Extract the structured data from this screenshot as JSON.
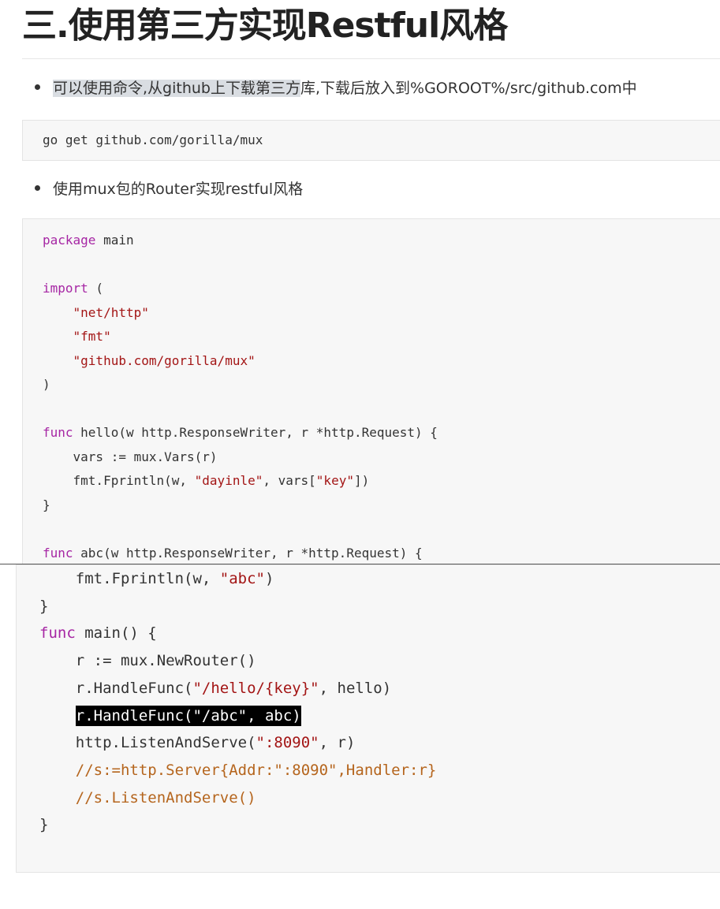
{
  "heading": "三.使用第三方实现Restful风格",
  "bullets": [
    {
      "highlighted": "可以使用命令,从github上下载第三方",
      "rest": "库,下载后放入到%GOROOT%/src/github.com中"
    },
    {
      "text": "使用mux包的Router实现restful风格"
    }
  ],
  "command": "go get github.com/gorilla/mux",
  "code_top": [
    [
      {
        "t": "package",
        "c": "kw"
      },
      {
        "t": " main"
      }
    ],
    [],
    [
      {
        "t": "import",
        "c": "kw"
      },
      {
        "t": " ("
      }
    ],
    [
      {
        "t": "    "
      },
      {
        "t": "\"net/http\"",
        "c": "str"
      }
    ],
    [
      {
        "t": "    "
      },
      {
        "t": "\"fmt\"",
        "c": "str"
      }
    ],
    [
      {
        "t": "    "
      },
      {
        "t": "\"github.com/gorilla/mux\"",
        "c": "str"
      }
    ],
    [
      {
        "t": ")"
      }
    ],
    [],
    [
      {
        "t": "func",
        "c": "kw"
      },
      {
        "t": " hello(w http.ResponseWriter, r *http.Request) {"
      }
    ],
    [
      {
        "t": "    vars := mux.Vars(r)"
      }
    ],
    [
      {
        "t": "    fmt.Fprintln(w, "
      },
      {
        "t": "\"dayinle\"",
        "c": "str"
      },
      {
        "t": ", vars["
      },
      {
        "t": "\"key\"",
        "c": "str"
      },
      {
        "t": "])"
      }
    ],
    [
      {
        "t": "}"
      }
    ],
    [],
    [
      {
        "t": "func",
        "c": "kw"
      },
      {
        "t": " abc(w http.ResponseWriter, r *http.Request) {"
      }
    ]
  ],
  "code_bottom": [
    [
      {
        "t": "    fmt.Fprintln(w, "
      },
      {
        "t": "\"abc\"",
        "c": "str"
      },
      {
        "t": ")"
      }
    ],
    [
      {
        "t": "}"
      }
    ],
    [
      {
        "t": "func",
        "c": "kw"
      },
      {
        "t": " main() {"
      }
    ],
    [
      {
        "t": "    r := mux.NewRouter()"
      }
    ],
    [
      {
        "t": "    r.HandleFunc("
      },
      {
        "t": "\"/hello/{key}\"",
        "c": "str"
      },
      {
        "t": ", hello)"
      }
    ],
    [
      {
        "t": "    "
      },
      {
        "t": "r.HandleFunc(\"/abc\", abc)",
        "c": "sel"
      }
    ],
    [
      {
        "t": "    http.ListenAndServe("
      },
      {
        "t": "\":8090\"",
        "c": "str"
      },
      {
        "t": ", r)"
      }
    ],
    [
      {
        "t": "    "
      },
      {
        "t": "//s:=http.Server{Addr:\":8090\",Handler:r}",
        "c": "cmt"
      }
    ],
    [
      {
        "t": "    "
      },
      {
        "t": "//s.ListenAndServe()",
        "c": "cmt"
      }
    ],
    [
      {
        "t": "}"
      }
    ]
  ]
}
